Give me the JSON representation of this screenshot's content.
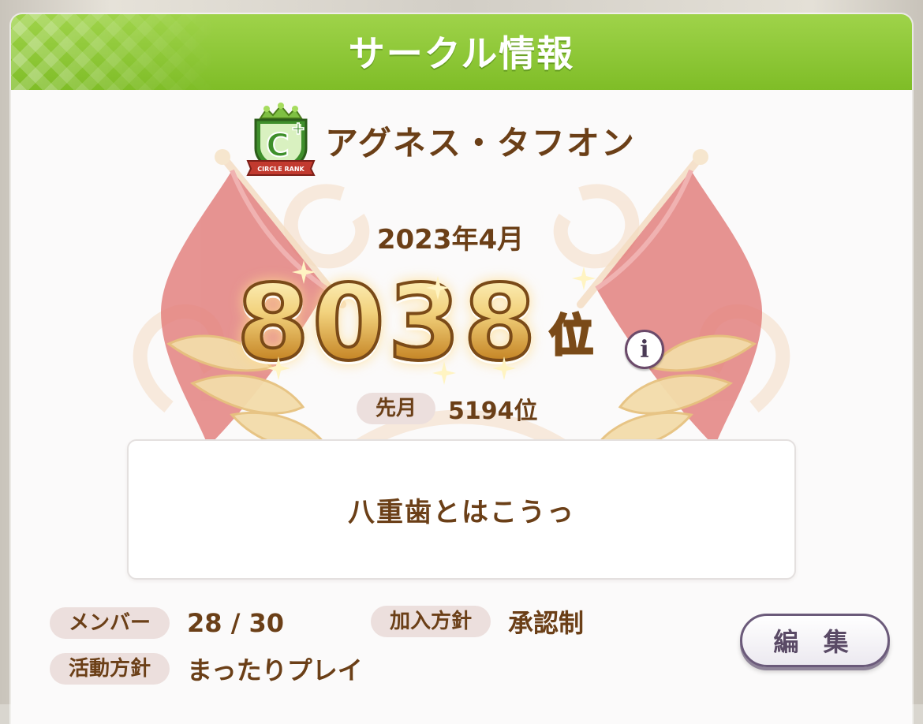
{
  "header": {
    "title": "サークル情報"
  },
  "circle": {
    "rank_badge_label": "CIRCLE RANK",
    "rank_badge_letter": "C",
    "name": "アグネス・タフオン"
  },
  "ranking": {
    "month": "2023年4月",
    "rank": "8038",
    "rank_suffix": "位",
    "info_icon_glyph": "i",
    "previous_label": "先月",
    "previous_value": "5194位"
  },
  "message": "八重歯とはこうっ",
  "details": {
    "members_label": "メンバー",
    "members_value": "28 / 30",
    "join_policy_label": "加入方針",
    "join_policy_value": "承認制",
    "activity_label": "活動方針",
    "activity_value": "まったりプレイ"
  },
  "edit_button_label": "編 集",
  "colors": {
    "header_green": "#8cc836",
    "text_brown": "#6b3f17",
    "pill_bg": "#ecdfdd",
    "flag_red": "#e07a78"
  }
}
